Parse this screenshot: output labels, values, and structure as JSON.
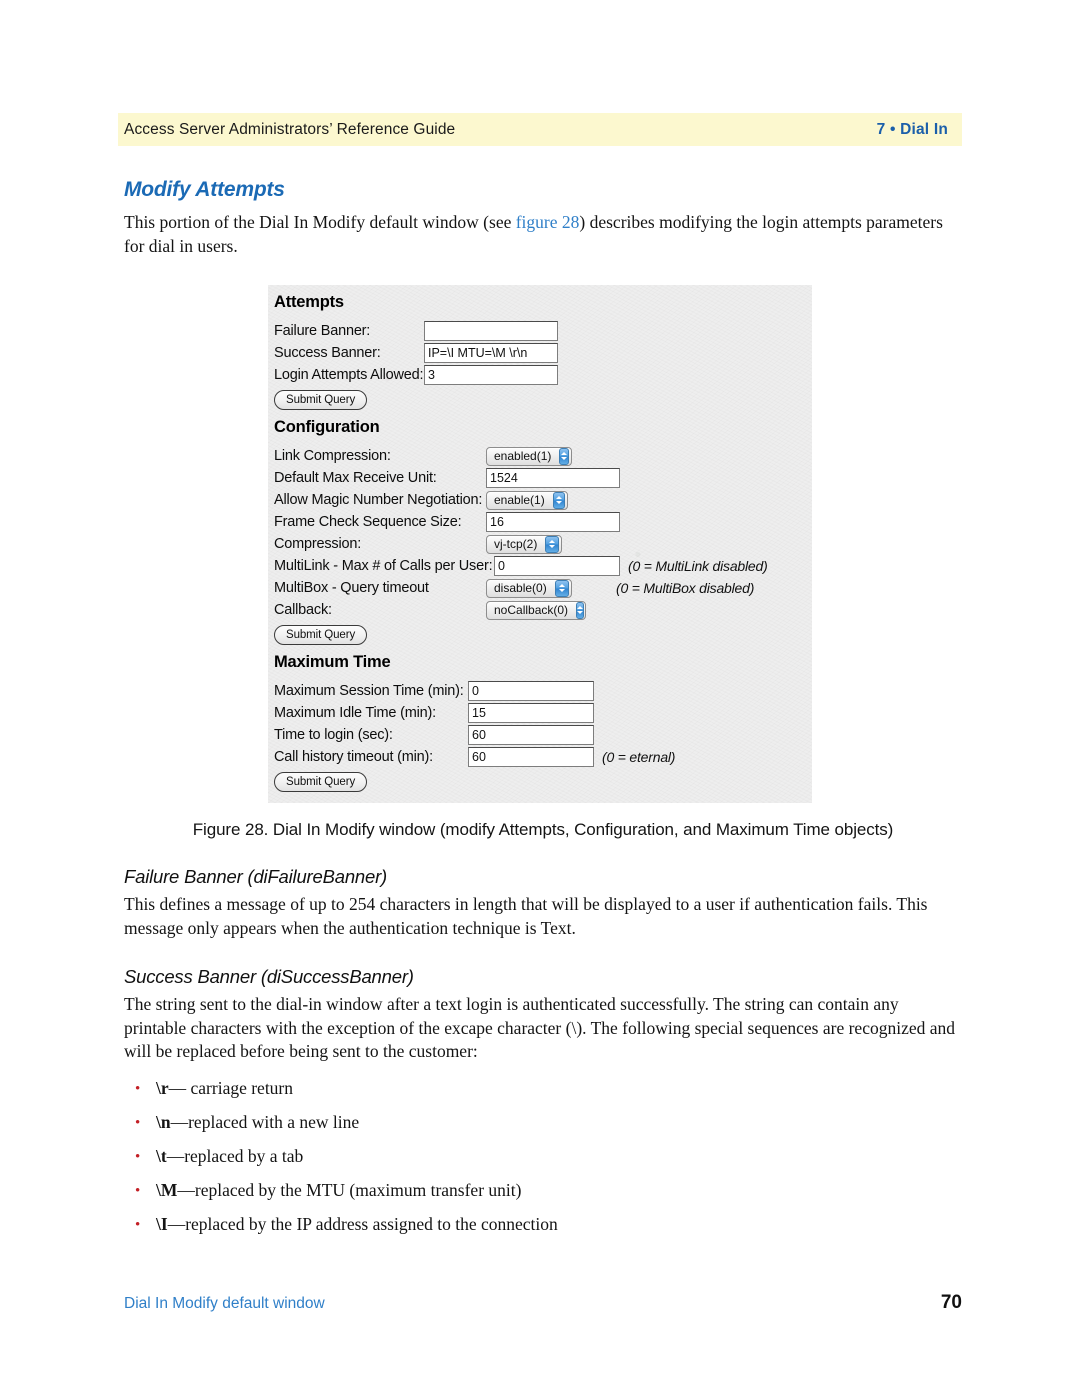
{
  "header": {
    "left": "Access Server Administrators’ Reference Guide",
    "right": "7 • Dial In",
    "band_color": "#fcf8cf",
    "accent_color": "#1b5faa"
  },
  "section": {
    "title": "Modify Attempts",
    "intro_before": "This portion of the Dial In Modify default window (see ",
    "intro_link": "figure 28",
    "intro_after": ") describes modifying the login attempts parameters for dial in users."
  },
  "figure": {
    "caption": "Figure 28. Dial In Modify window (modify Attempts, Configuration, and Maximum Time objects)",
    "attempts": {
      "heading": "Attempts",
      "rows": [
        {
          "label": "Failure Banner:",
          "value": "",
          "control": "text"
        },
        {
          "label": "Success Banner:",
          "value": "IP=\\I MTU=\\M \\r\\n",
          "control": "text"
        },
        {
          "label": "Login Attempts Allowed:",
          "value": "3",
          "control": "text"
        }
      ],
      "submit_label": "Submit Query"
    },
    "configuration": {
      "heading": "Configuration",
      "rows": [
        {
          "label": "Link Compression:",
          "value": "enabled(1)",
          "control": "select",
          "note": ""
        },
        {
          "label": "Default Max Receive Unit:",
          "value": "1524",
          "control": "text",
          "note": ""
        },
        {
          "label": "Allow Magic Number Negotiation:",
          "value": "enable(1)",
          "control": "select",
          "note": ""
        },
        {
          "label": "Frame Check Sequence Size:",
          "value": "16",
          "control": "text",
          "note": ""
        },
        {
          "label": "Compression:",
          "value": "vj-tcp(2)",
          "control": "select",
          "note": ""
        },
        {
          "label": "MultiLink - Max # of Calls per User:",
          "value": "0",
          "control": "text",
          "note": "(0 = MultiLink disabled)"
        },
        {
          "label": "MultiBox - Query timeout",
          "value": "disable(0)",
          "control": "select",
          "note": "(0 = MultiBox disabled)"
        },
        {
          "label": "Callback:",
          "value": "noCallback(0)",
          "control": "select",
          "note": ""
        }
      ],
      "submit_label": "Submit Query"
    },
    "maximum_time": {
      "heading": "Maximum Time",
      "rows": [
        {
          "label": "Maximum Session Time (min):",
          "value": "0",
          "control": "text",
          "note": ""
        },
        {
          "label": "Maximum Idle Time (min):",
          "value": "15",
          "control": "text",
          "note": ""
        },
        {
          "label": "Time to login (sec):",
          "value": "60",
          "control": "text",
          "note": ""
        },
        {
          "label": "Call history timeout (min):",
          "value": "60",
          "control": "text",
          "note": "(0 = eternal)"
        }
      ],
      "submit_label": "Submit Query"
    }
  },
  "failure_banner": {
    "title": "Failure Banner (diFailureBanner)",
    "body": "This defines a message of up to 254 characters in length that will be displayed to a user if authentication fails. This message only appears when the authentication technique is Text."
  },
  "success_banner": {
    "title": "Success Banner (diSuccessBanner)",
    "body": "The string sent to the dial-in window after a text login is authenticated successfully. The string can contain any printable characters with the exception of the excape character (\\). The following special sequences are recognized and will be replaced before being sent to the customer:",
    "bullets": [
      {
        "code": "\\r",
        "text": "— carriage return"
      },
      {
        "code": "\\n",
        "text": "—replaced with a new line"
      },
      {
        "code": "\\t",
        "text": "—replaced by a tab"
      },
      {
        "code": "\\M",
        "text": "—replaced by the MTU (maximum transfer unit)"
      },
      {
        "code": "\\I",
        "text": "—replaced by the IP address assigned to the connection"
      }
    ]
  },
  "footer": {
    "left": "Dial In Modify default window",
    "page_number": "70",
    "link_color": "#2f7fc8"
  }
}
